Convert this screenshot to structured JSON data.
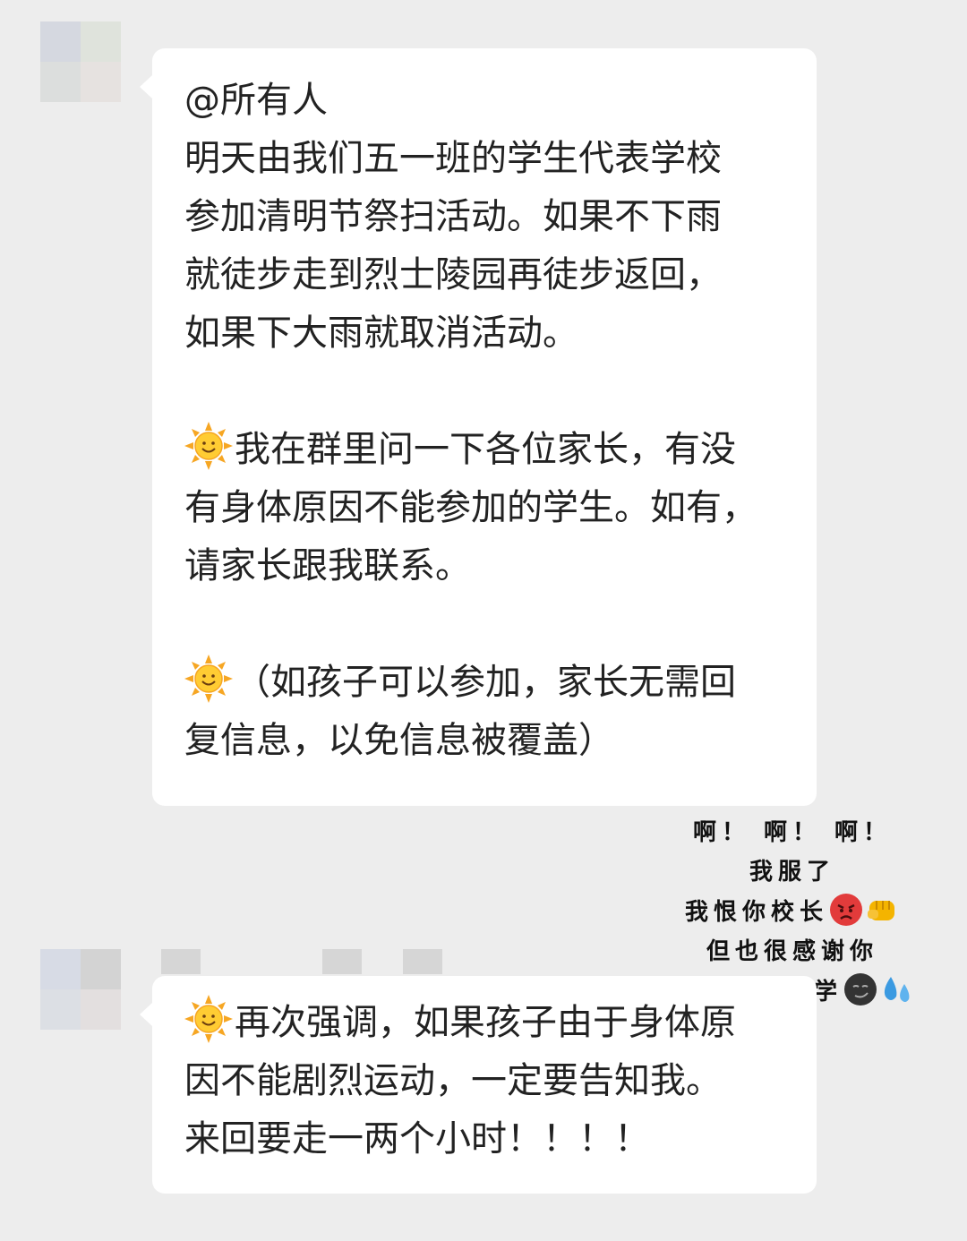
{
  "chat": {
    "message_1": {
      "mention": "@所有人",
      "paragraph_1": [
        "明天由我们五一班的学生代表学校",
        "参加清明节祭扫活动。如果不下雨",
        "就徒步走到烈士陵园再徒步返回，",
        "如果下大雨就取消活动。"
      ],
      "paragraph_2": [
        "我在群里问一下各位家长，有没",
        "有身体原因不能参加的学生。如有，",
        "请家长跟我联系。"
      ],
      "paragraph_3": [
        "（如孩子可以参加，家长无需回",
        "复信息，以免信息被覆盖）"
      ]
    },
    "message_2": {
      "lines": [
        "再次强调，如果孩子由于身体原",
        "因不能剧烈运动，一定要告知我。",
        "来回要走一两个小时！！！！"
      ]
    },
    "annotation": {
      "line_1": "啊！ 啊！ 啊！",
      "line_2": "我服了",
      "line_3": "我恨你校长",
      "line_4": "但也很感谢你",
      "line_5": "上午不用上学"
    }
  },
  "icons": {
    "sun": "sun-with-face-emoji",
    "angry": "angry-face-emoji",
    "fist": "oncoming-fist-emoji",
    "smirk": "smirking-dark-face-emoji",
    "sweat": "sweat-droplets-emoji"
  },
  "colors": {
    "background": "#ededed",
    "bubble": "#ffffff",
    "text": "#222222"
  }
}
